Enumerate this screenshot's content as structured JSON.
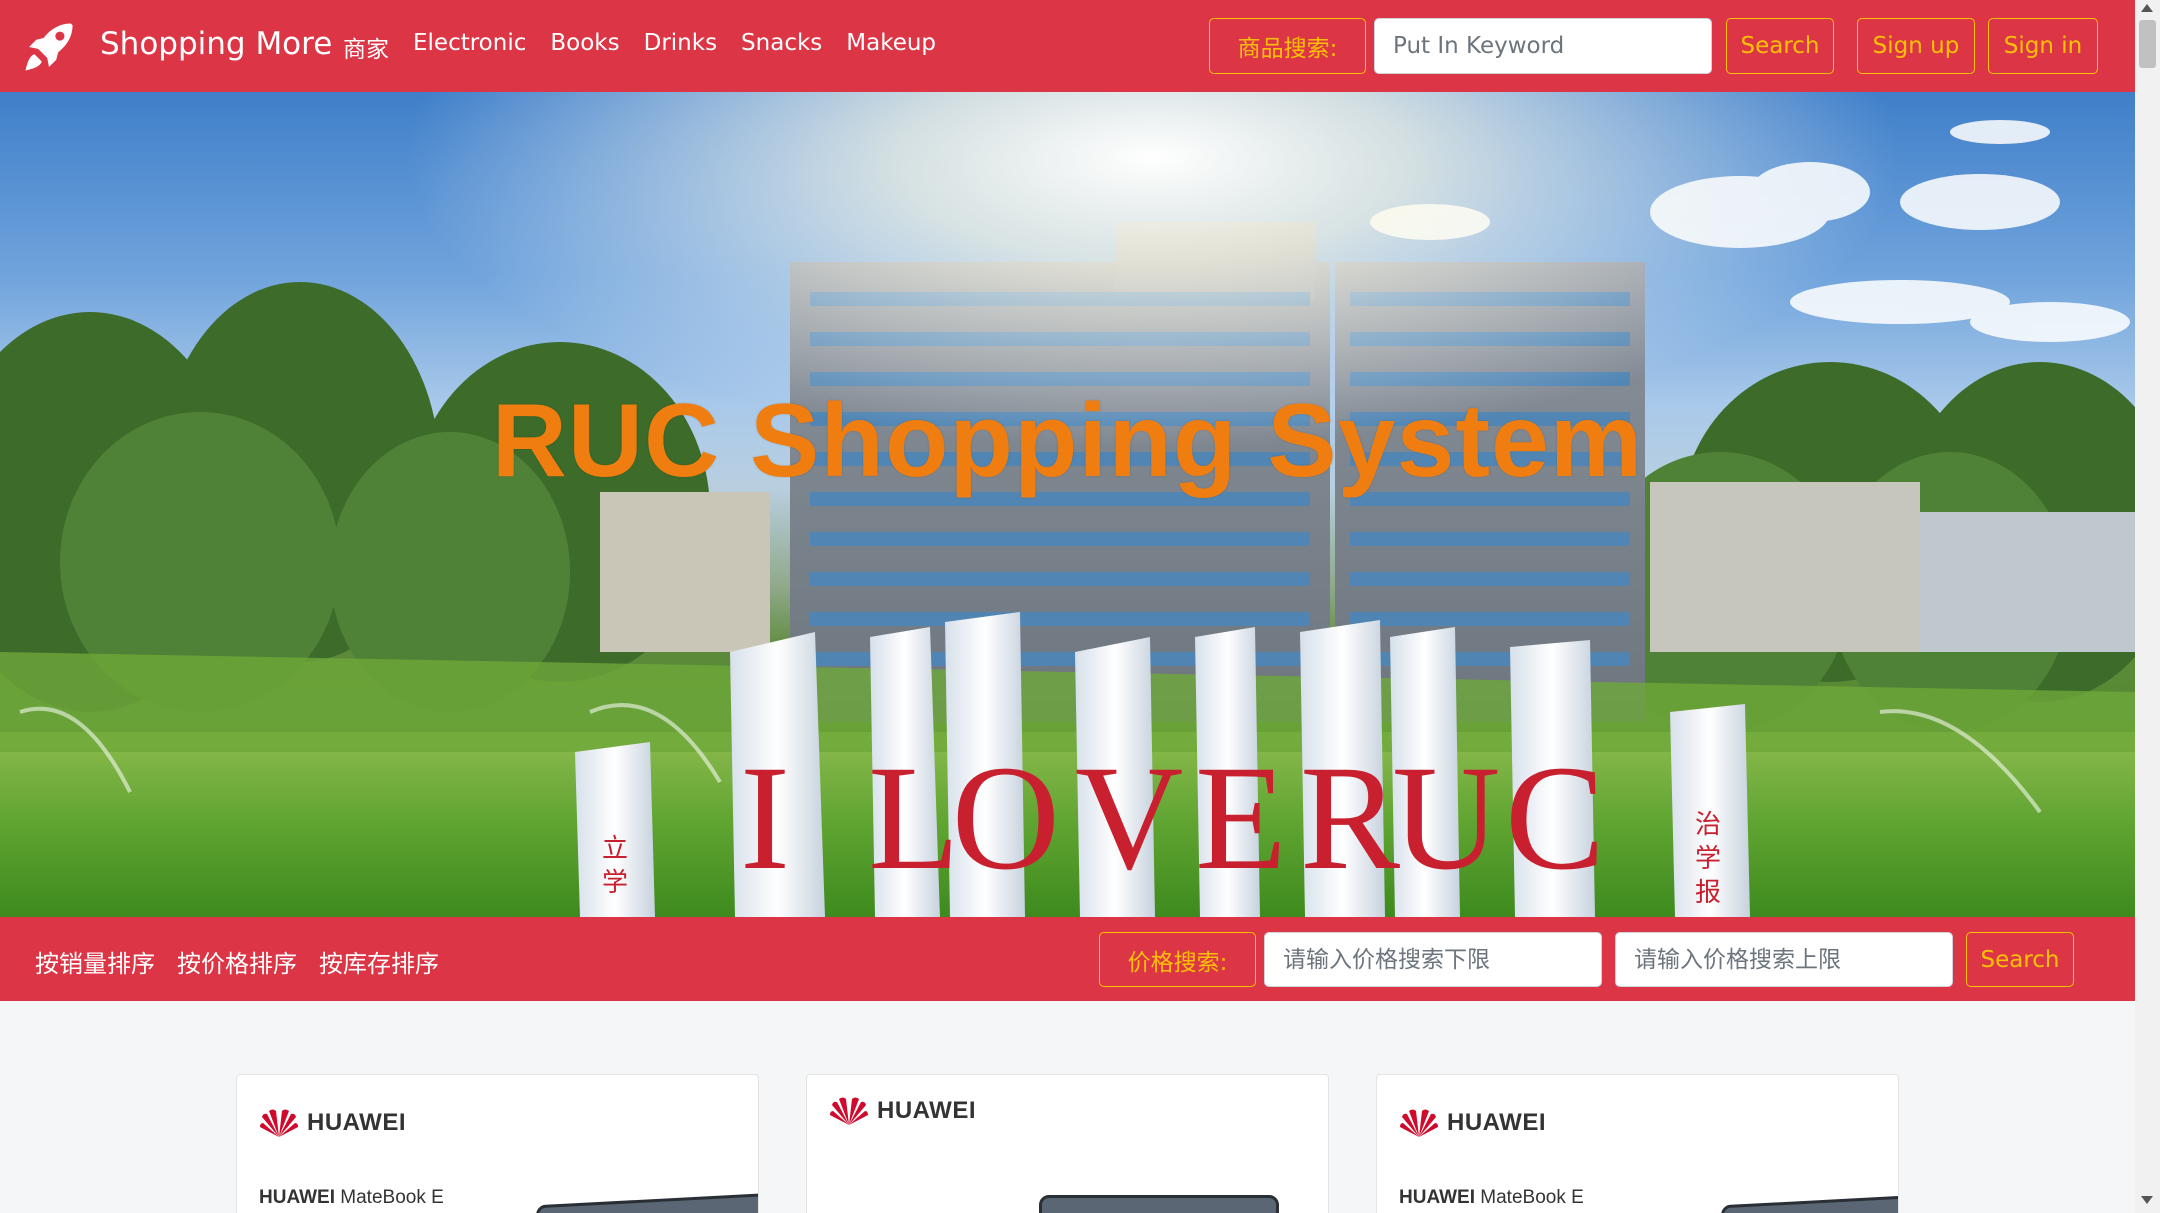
{
  "navbar": {
    "brand": "Shopping More",
    "links": [
      "商家",
      "Electronic",
      "Books",
      "Drinks",
      "Snacks",
      "Makeup"
    ],
    "search_prefix": "商品搜索:",
    "search_placeholder": "Put In Keyword",
    "search_button": "Search",
    "signup_button": "Sign up",
    "signin_button": "Sign in"
  },
  "hero": {
    "title": "RUC Shopping System",
    "sign_letters": [
      "I",
      "LO",
      "V",
      "E",
      "RU",
      "C"
    ],
    "side_text_left": "立学",
    "side_text_right": "治学报"
  },
  "filterbar": {
    "sort_links": [
      "按销量排序",
      "按价格排序",
      "按库存排序"
    ],
    "price_prefix": "价格搜索:",
    "price_min_placeholder": "请输入价格搜索下限",
    "price_max_placeholder": "请输入价格搜索上限",
    "search_button": "Search"
  },
  "products": [
    {
      "brand": "HUAWEI",
      "model_brand": "HUAWEI",
      "model_name": " MateBook E"
    },
    {
      "brand": "HUAWEI",
      "model_brand": "",
      "model_name": ""
    },
    {
      "brand": "HUAWEI",
      "model_brand": "HUAWEI",
      "model_name": " MateBook E"
    }
  ],
  "colors": {
    "primary": "#dc3545",
    "accent": "#ffc107",
    "hero_title": "#ef7d0f",
    "huawei_red": "#cf0a2c"
  },
  "icons": {
    "brand": "rocket-icon"
  }
}
